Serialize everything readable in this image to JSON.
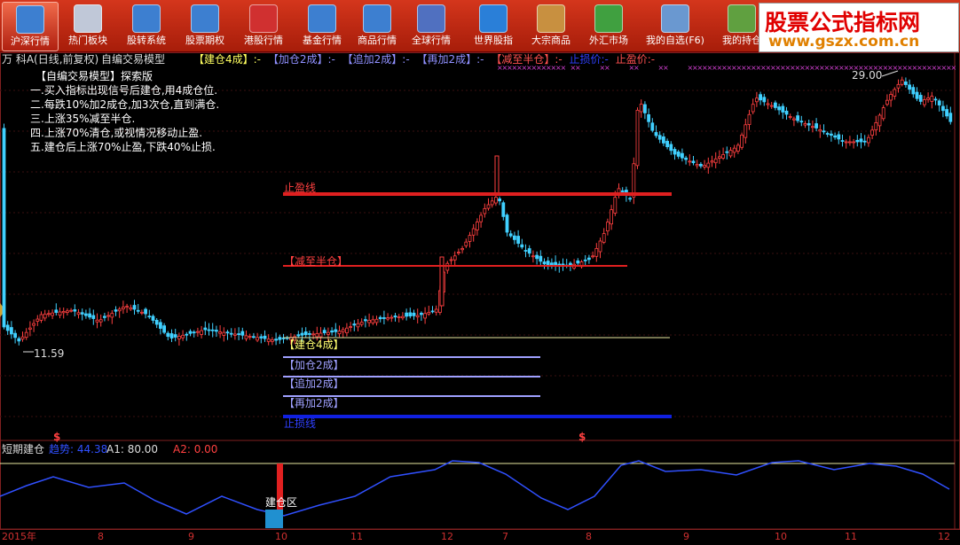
{
  "toolbar": {
    "buttons": [
      {
        "label": "沪深行情",
        "icon": "monitor-chart-icon",
        "color": "#3d7fd0",
        "active": true
      },
      {
        "label": "热门板块",
        "icon": "pie-chart-icon",
        "color": "#c0c8d8"
      },
      {
        "label": "股转系统",
        "icon": "monitor-chart-icon",
        "color": "#3d7fd0"
      },
      {
        "label": "股票期权",
        "icon": "monitor-chart-icon",
        "color": "#3d7fd0"
      },
      {
        "label": "港股行情",
        "icon": "hk-flag-chart-icon",
        "color": "#d03030"
      },
      {
        "label": "基金行情",
        "icon": "fund-coins-icon",
        "color": "#3d7fd0"
      },
      {
        "label": "商品行情",
        "icon": "commodity-chart-icon",
        "color": "#3d7fd0"
      },
      {
        "label": "全球行情",
        "icon": "globe-cards-icon",
        "color": "#5070c0"
      },
      {
        "label": "世界股指",
        "icon": "globe-icon",
        "color": "#2a7fd8"
      },
      {
        "label": "大宗商品",
        "icon": "crate-icon",
        "color": "#c89040"
      },
      {
        "label": "外汇市场",
        "icon": "banknotes-icon",
        "color": "#40a040"
      },
      {
        "label": "我的自选(F6)",
        "icon": "user-monitor-icon",
        "color": "#6a98d0"
      },
      {
        "label": "我的持仓",
        "icon": "clock-icon",
        "color": "#60a040"
      }
    ]
  },
  "watermark": {
    "line1": "股票公式指标网",
    "line2": "www.gszx.com.cn"
  },
  "chart": {
    "stock_title": "万 科A(日线,前复权)",
    "formula_name": "自编交易模型",
    "legend_items": [
      {
        "text": "【建仓4成】:-",
        "color": "#ffff60"
      },
      {
        "text": "【加仓2成】:-",
        "color": "#9090ff"
      },
      {
        "text": "【追加2成】:-",
        "color": "#9090ff"
      },
      {
        "text": "【再加2成】:-",
        "color": "#9090ff"
      },
      {
        "text": "【减至半仓】:-",
        "color": "#ff5050"
      },
      {
        "text": "止损价:-",
        "color": "#3040ff"
      },
      {
        "text": "止盈价:-",
        "color": "#ff5050"
      }
    ],
    "notes_title": "【自编交易模型】探索版",
    "notes": [
      "一.买入指标出现信号后建仓,用4成仓位.",
      "二.每跌10%加2成仓,加3次仓,直到满仓.",
      "三.上涨35%减至半仓.",
      "四.上涨70%清仓,或视情况移动止盈.",
      "五.建仓后上涨70%止盈,下跌40%止损."
    ],
    "line_labels": {
      "take_profit": "止盈线",
      "reduce_half": "【减至半仓】",
      "build_40": "【建仓4成】",
      "add_20": "【加仓2成】",
      "chase_20": "【追加2成】",
      "again_20": "【再加2成】",
      "stop_loss": "止损线"
    },
    "price_high_label": "29.00",
    "price_low_label": "11.59",
    "signal_marker": "$"
  },
  "indicator": {
    "name": "短期建仓",
    "trend_label": "趋势: 44.38",
    "a1_label": "A1: 80.00",
    "a2_label": "A2: 0.00",
    "zone_label": "建仓区"
  },
  "axis": {
    "labels": [
      {
        "text": "2015年"
      },
      {
        "text": "8"
      },
      {
        "text": "9"
      },
      {
        "text": "10"
      },
      {
        "text": "11"
      },
      {
        "text": "12"
      },
      {
        "text": "7"
      },
      {
        "text": "8"
      },
      {
        "text": "9"
      },
      {
        "text": "10"
      },
      {
        "text": "11"
      },
      {
        "text": "12"
      }
    ]
  },
  "colors": {
    "up": "#ff4040",
    "down": "#40d0ff",
    "toolbar": "#c0260f",
    "bg": "#000000"
  }
}
